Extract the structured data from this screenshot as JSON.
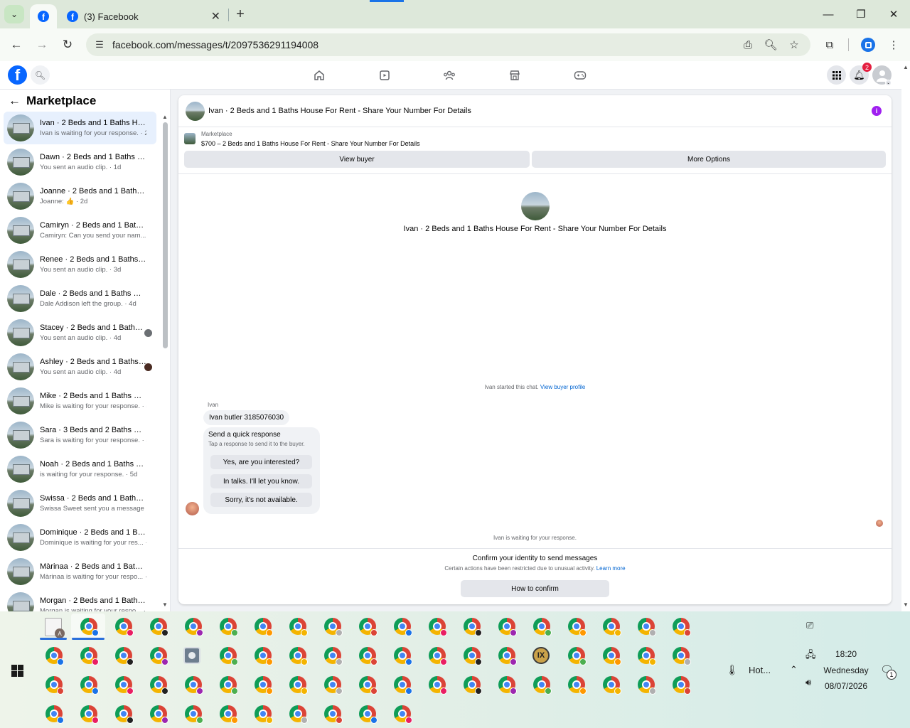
{
  "browser": {
    "tab_title": "(3) Facebook",
    "url": "facebook.com/messages/t/2097536291194008"
  },
  "fb": {
    "notification_count": "2"
  },
  "sidebar": {
    "title": "Marketplace",
    "conversations": [
      {
        "name": "Ivan · 2 Beds and 1 Baths Hous...",
        "sub": "Ivan is waiting for your response. · 2h"
      },
      {
        "name": "Dawn · 2 Beds and 1 Baths Hou...",
        "sub": "You sent an audio clip. · 1d"
      },
      {
        "name": "Joanne · 2 Beds and 1 Baths Ho...",
        "sub": "Joanne: 👍 · 2d"
      },
      {
        "name": "Camiryn · 2 Beds and 1 Baths H...",
        "sub": "Camiryn: Can you send your nam... · 2d"
      },
      {
        "name": "Renee · 2 Beds and 1 Baths Hou...",
        "sub": "You sent an audio clip. · 3d"
      },
      {
        "name": "Dale · 2 Beds and 1 Baths Hous...",
        "sub": "Dale Addison left the group. · 4d"
      },
      {
        "name": "Stacey · 2 Beds and 1 Baths H...",
        "sub": "You sent an audio clip. · 4d"
      },
      {
        "name": "Ashley · 2 Beds and 1 Baths ...",
        "sub": "You sent an audio clip. · 4d"
      },
      {
        "name": "Mike · 2 Beds and 1 Baths Hous...",
        "sub": "Mike is waiting for your response. · 5d"
      },
      {
        "name": "Sara · 3 Beds and 2 Baths Hous...",
        "sub": "Sara is waiting for your response. · 5d"
      },
      {
        "name": "Noah · 2 Beds and 1 Baths Hou...",
        "sub": "is waiting for your response. · 5d"
      },
      {
        "name": "Swissa · 2 Beds and 1 Baths Ho...",
        "sub": "Swissa Sweet sent you a message ... · 5d"
      },
      {
        "name": "Dominique · 2 Beds and 1 Bath...",
        "sub": "Dominique is waiting for your res... · 6d"
      },
      {
        "name": "Màrinaa · 2 Beds and 1 Baths H...",
        "sub": "Màrinaa is waiting for your respo... · 6d"
      },
      {
        "name": "Morgan · 2 Beds and 1 Baths H...",
        "sub": "Morgan is waiting for your respo... · 6d"
      }
    ]
  },
  "chat": {
    "header_title": "Ivan · 2 Beds and 1 Baths House For Rent - Share Your Number For Details",
    "marketplace_label": "Marketplace",
    "listing_line": "$700 – 2 Beds and 1 Baths House For Rent - Share Your Number For Details",
    "view_buyer": "View buyer",
    "more_options": "More Options",
    "intro_title": "Ivan · 2 Beds and 1 Baths House For Rent - Share Your Number For Details",
    "started_text": "Ivan started this chat.",
    "buyer_profile_link": "View buyer profile",
    "sender_name": "Ivan",
    "message": "Ivan butler 3185076030",
    "quick_title": "Send a quick response",
    "quick_sub": "Tap a response to send it to the buyer.",
    "quick_options": [
      "Yes, are you interested?",
      "In talks. I'll let you know.",
      "Sorry, it's not available."
    ],
    "waiting_text": "Ivan is waiting for your response.",
    "confirm_title": "Confirm your identity to send messages",
    "confirm_sub": "Certain actions have been restricted due to unusual activity.",
    "learn_more": "Learn more",
    "confirm_button": "How to confirm"
  },
  "taskbar": {
    "weather": "Hot...",
    "time": "18:20",
    "day": "Wednesday",
    "date": "08/07/2026",
    "file_avatar_letter": "A",
    "notification_count": "1"
  }
}
